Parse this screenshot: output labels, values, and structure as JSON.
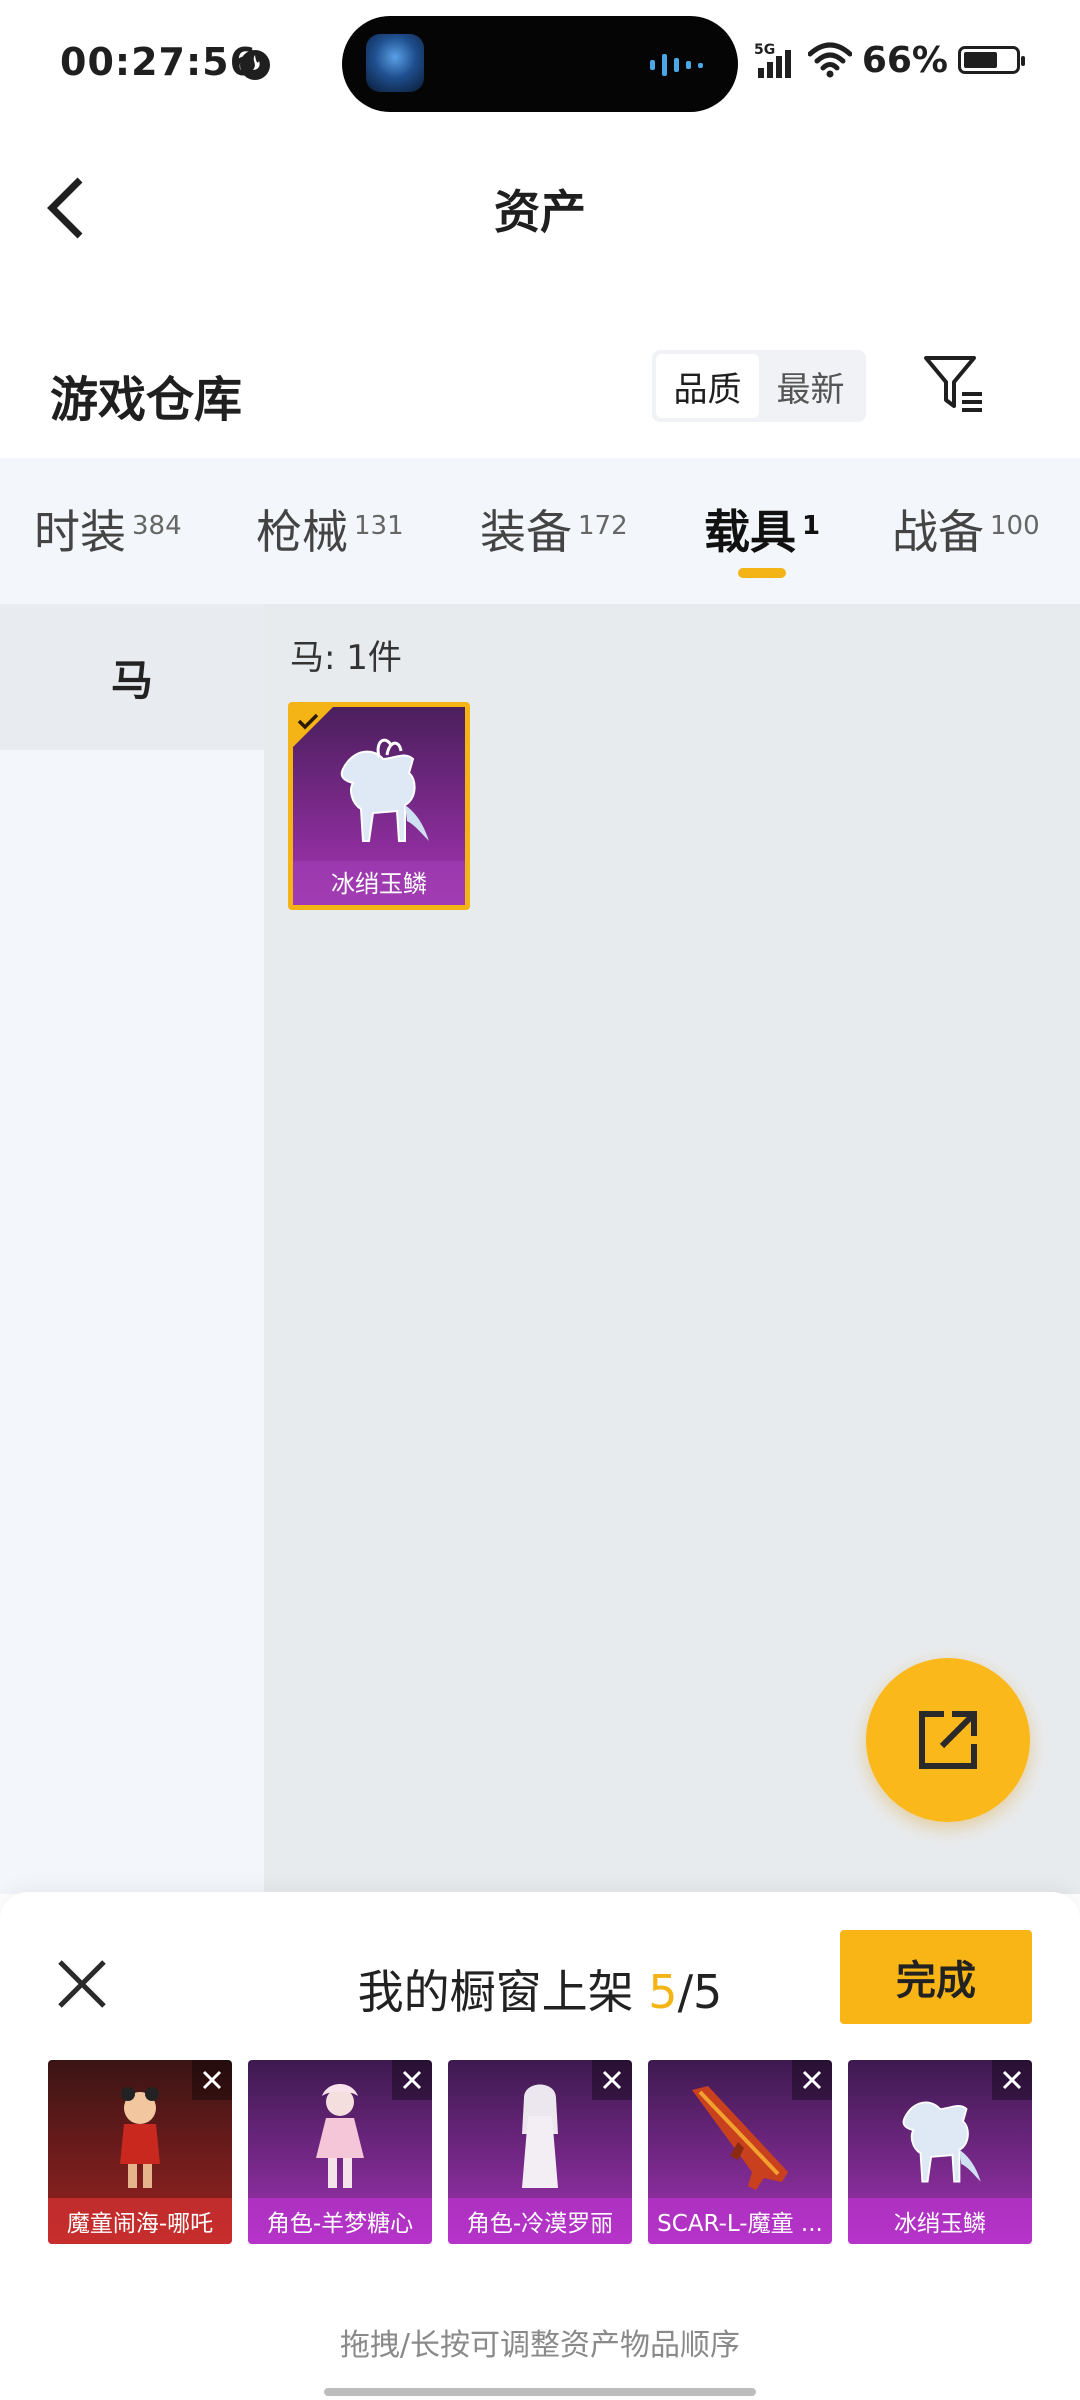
{
  "status": {
    "time": "00:27:56",
    "network": "5G",
    "battery_pct": "66%",
    "battery_level": 0.66
  },
  "header": {
    "title": "资产"
  },
  "warehouse": {
    "title": "游戏仓库",
    "sort_quality": "品质",
    "sort_latest": "最新"
  },
  "tabs": [
    {
      "label": "时装",
      "count": "384"
    },
    {
      "label": "枪械",
      "count": "131"
    },
    {
      "label": "装备",
      "count": "172"
    },
    {
      "label": "载具",
      "count": "1"
    },
    {
      "label": "战备",
      "count": "100"
    }
  ],
  "sidebar": {
    "items": [
      {
        "label": "马"
      }
    ]
  },
  "main": {
    "count_label": "马: 1件",
    "items": [
      {
        "name": "冰绡玉鳞",
        "selected": true
      }
    ]
  },
  "sheet": {
    "title_prefix": "我的橱窗上架",
    "current": "5",
    "total": "/5",
    "done_label": "完成",
    "items": [
      {
        "label": "魔童闹海-哪吒",
        "theme": "red"
      },
      {
        "label": "角色-羊梦糖心",
        "theme": "purple"
      },
      {
        "label": "角色-冷漠罗丽",
        "theme": "purple"
      },
      {
        "label": "SCAR-L-魔童 ...",
        "theme": "purple"
      },
      {
        "label": "冰绡玉鳞",
        "theme": "purple"
      }
    ],
    "hint": "拖拽/长按可调整资产物品顺序"
  },
  "colors": {
    "accent": "#f5b416",
    "panel": "#f3f6fa",
    "content_bg": "#e8ebee"
  }
}
